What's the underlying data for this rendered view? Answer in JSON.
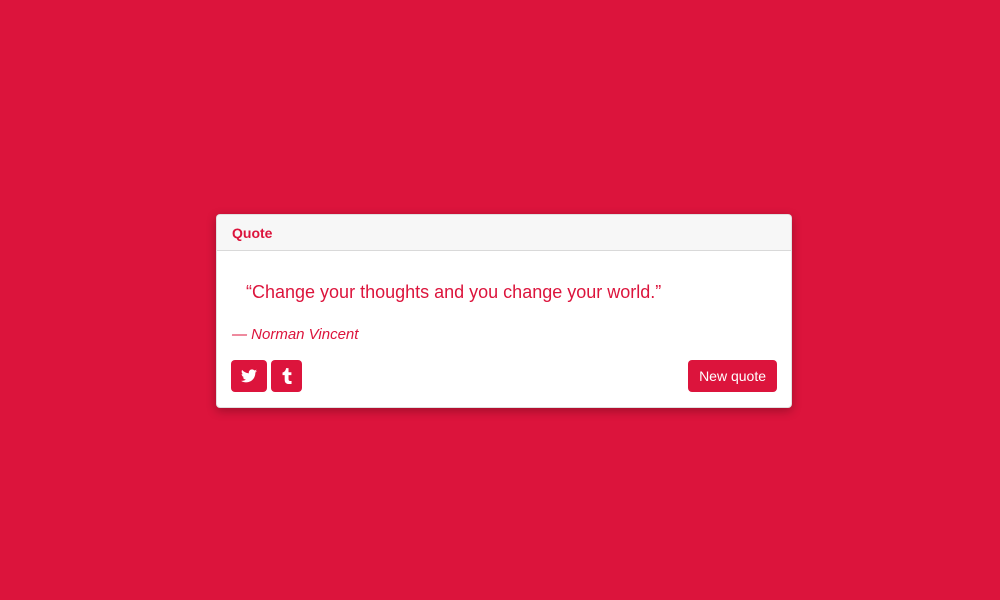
{
  "card": {
    "title": "Quote"
  },
  "quote": {
    "text": "“Change your thoughts and you change your world.”",
    "author": "— Norman Vincent"
  },
  "actions": {
    "twitter_icon": "twitter-icon",
    "tumblr_icon": "tumblr-icon",
    "new_quote_label": "New quote"
  },
  "colors": {
    "background": "#dc143c",
    "accent": "#dc143c",
    "card": "#ffffff",
    "header": "#f7f7f7"
  }
}
